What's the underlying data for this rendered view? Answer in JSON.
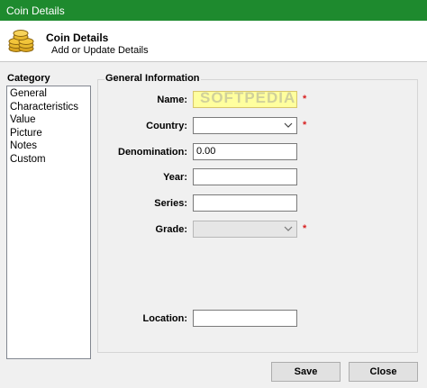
{
  "window": {
    "title": "Coin Details"
  },
  "header": {
    "title": "Coin Details",
    "subtitle": "Add or Update Details",
    "icon": "coin-stack-icon"
  },
  "category": {
    "label": "Category",
    "items": [
      "General",
      "Characteristics",
      "Value",
      "Picture",
      "Notes",
      "Custom"
    ]
  },
  "general": {
    "label": "General Information",
    "name": {
      "label": "Name:",
      "value": "",
      "required": "*"
    },
    "country": {
      "label": "Country:",
      "value": "",
      "required": "*"
    },
    "denomination": {
      "label": "Denomination:",
      "value": "0.00"
    },
    "year": {
      "label": "Year:",
      "value": ""
    },
    "series": {
      "label": "Series:",
      "value": ""
    },
    "grade": {
      "label": "Grade:",
      "value": "",
      "required": "*"
    },
    "location": {
      "label": "Location:",
      "value": ""
    }
  },
  "watermark": "SOFTPEDIA",
  "buttons": {
    "save": "Save",
    "close": "Close"
  },
  "colors": {
    "titlebar": "#1e8a2e",
    "required": "#d82020",
    "highlight": "#ffff9e"
  }
}
